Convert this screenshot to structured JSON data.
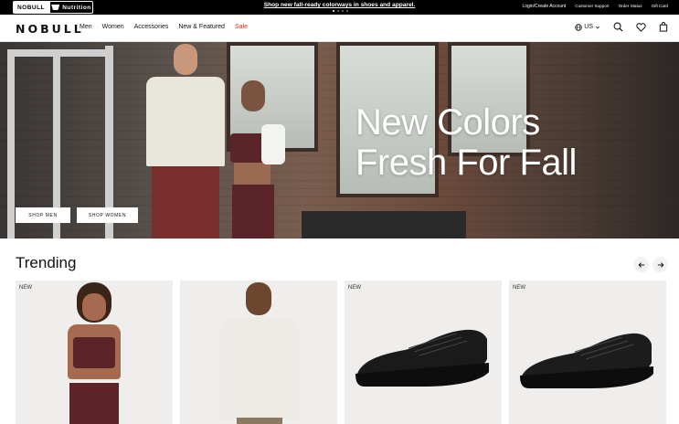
{
  "topbar": {
    "brand_tabs": [
      "NOBULL",
      "Nutrition"
    ],
    "promo": "Shop new fall-ready colorways in shoes and apparel.",
    "links": [
      "Login/Create Account",
      "Customer Support",
      "Order Status",
      "Gift Card"
    ]
  },
  "header": {
    "logo": "NOBULL",
    "nav": [
      "Men",
      "Women",
      "Accessories",
      "New & Featured",
      "Sale"
    ],
    "region": "US"
  },
  "hero": {
    "headline_line1": "New Colors",
    "headline_line2": "Fresh For Fall",
    "shop_men": "SHOP MEN",
    "shop_women": "SHOP WOMEN"
  },
  "trending": {
    "title": "Trending",
    "cards": [
      {
        "badge": "NEW"
      },
      {
        "badge": ""
      },
      {
        "badge": "NEW"
      },
      {
        "badge": "NEW"
      }
    ]
  },
  "colors": {
    "sale": "#c0392b",
    "topbar_bg": "#000000",
    "card_bg": "#efeeec"
  }
}
